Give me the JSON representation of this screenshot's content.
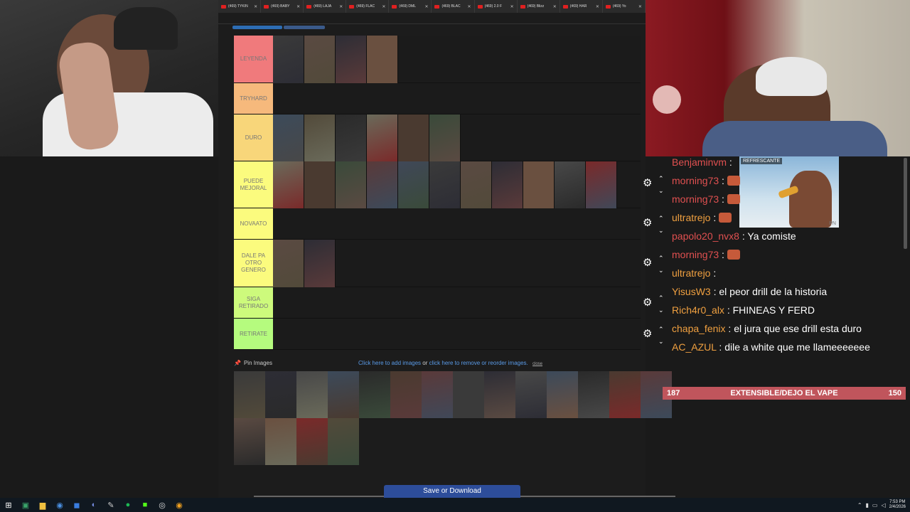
{
  "browser": {
    "tabs": [
      "(469) TYKIN",
      "(469) BABY",
      "(469) LAJA",
      "(469) FLAC",
      "(469) DML",
      "(469) BLAC",
      "(469) 2.0 F",
      "(469) Blizz",
      "(469) HAR",
      "(469) Yo"
    ]
  },
  "tiers": [
    {
      "label": "LEYENDA",
      "color": "#f07a7c",
      "items": 4
    },
    {
      "label": "TRYHARD",
      "color": "#f6b97c",
      "items": 0
    },
    {
      "label": "DURO",
      "color": "#f8d67a",
      "items": 6
    },
    {
      "label": "PUEDE MEJORAL",
      "color": "#fbfb7e",
      "items": 11
    },
    {
      "label": "NOVAATO",
      "color": "#fbfb7e",
      "items": 0
    },
    {
      "label": "DALE PA OTRO GENERO",
      "color": "#fbfb7e",
      "items": 2
    },
    {
      "label": "SIGA RETIRADO",
      "color": "#cdfa7c",
      "items": 0
    },
    {
      "label": "RETIRATE",
      "color": "#b5fb7e",
      "items": 0
    }
  ],
  "pool": {
    "pin_label": "Pin Images",
    "add_text_1": "Click here to add images",
    "add_text_or": " or ",
    "add_text_2": "click here to remove or reorder images.",
    "close_text": "close",
    "row1_count": 14,
    "row2_count": 4
  },
  "save_label": "Save or Download",
  "chat": {
    "messages": [
      {
        "user": "Benjaminvm",
        "color": "#e05050",
        "text": "",
        "emote": false
      },
      {
        "user": "morning73",
        "color": "#e05050",
        "text": "",
        "emote": true
      },
      {
        "user": "morning73",
        "color": "#e05050",
        "text": "",
        "emote": true
      },
      {
        "user": "ultratrejo",
        "color": "#f0a040",
        "text": "",
        "emote": true
      },
      {
        "user": "papolo20_nvx8",
        "color": "#e05050",
        "text": "Ya comiste",
        "emote": false
      },
      {
        "user": "morning73",
        "color": "#e05050",
        "text": "",
        "emote": true
      },
      {
        "user": "ultratrejo",
        "color": "#f0a040",
        "text": "",
        "emote": false
      },
      {
        "user": "YisusW3",
        "color": "#f0a040",
        "text": "el peor drill de la historia",
        "emote": false
      },
      {
        "user": "Rich4r0_alx",
        "color": "#f0a040",
        "text": "FHINEAS Y FERD",
        "emote": false
      },
      {
        "user": "chapa_fenix",
        "color": "#f0a040",
        "text": "el jura que ese drill esta duro",
        "emote": false
      },
      {
        "user": "AC_AZUL",
        "color": "#f0a040",
        "text": "dile a white que me llameeeeeee",
        "emote": false
      }
    ],
    "ad_label": "REFRESCANTE",
    "ad_corner": "PN"
  },
  "goal": {
    "left": "187",
    "label": "EXTENSIBLE/DEJO EL VAPE",
    "right": "150"
  },
  "taskbar": {
    "time": "7:53 PM",
    "date": "2/4/2026"
  }
}
